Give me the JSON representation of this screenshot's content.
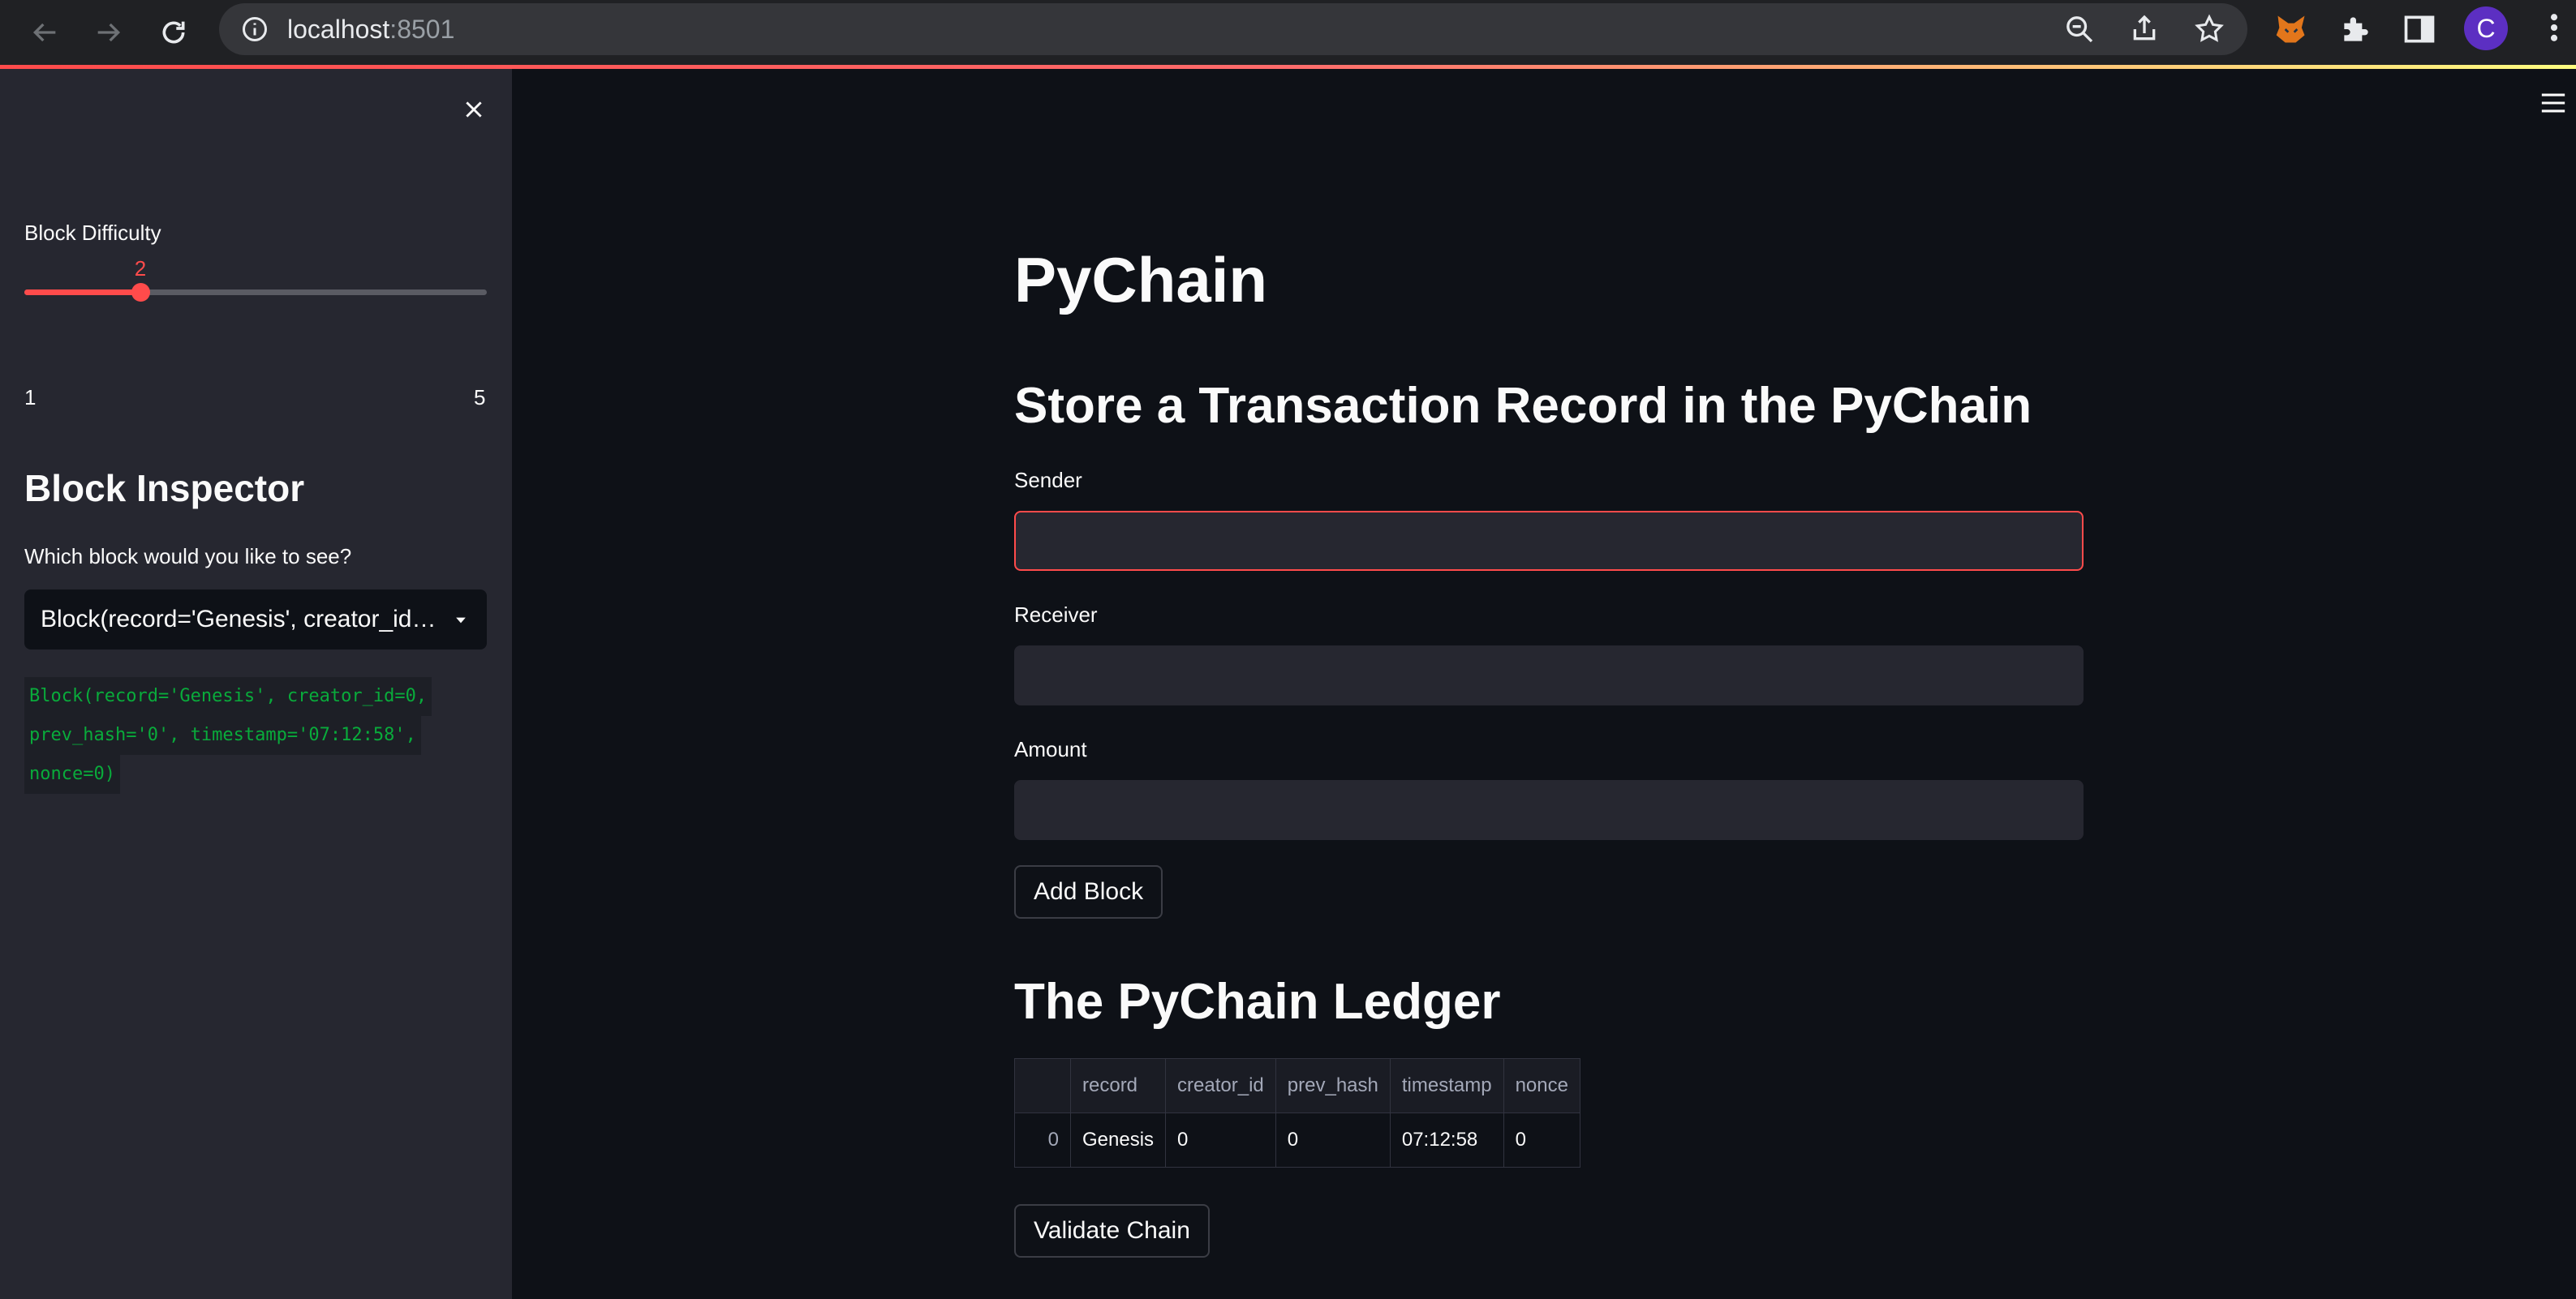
{
  "browser": {
    "url_host": "localhost",
    "url_port": ":8501",
    "profile_initial": "C"
  },
  "colors": {
    "accent": "#ff4b4b",
    "background": "#0e1117",
    "sidebar": "#262730",
    "code_text": "#09ab3b"
  },
  "sidebar": {
    "difficulty_label": "Block Difficulty",
    "slider": {
      "min": 1,
      "max": 5,
      "value": 2,
      "min_label": "1",
      "max_label": "5",
      "value_label": "2"
    },
    "inspector_title": "Block Inspector",
    "inspector_question": "Which block would you like to see?",
    "selected_block": "Block(record='Genesis', creator_id=0, prev_hash='0', timestamp='07:12:58', nonce=0)",
    "code_lines": [
      "Block(record='Genesis', creator_id=0,",
      "prev_hash='0', timestamp='07:12:58',",
      "nonce=0)"
    ]
  },
  "main": {
    "title": "PyChain",
    "form_title": "Store a Transaction Record in the PyChain",
    "sender_label": "Sender",
    "sender_value": "",
    "receiver_label": "Receiver",
    "receiver_value": "",
    "amount_label": "Amount",
    "amount_value": "",
    "add_block_label": "Add Block",
    "ledger_title": "The PyChain Ledger",
    "ledger": {
      "columns": [
        "record",
        "creator_id",
        "prev_hash",
        "timestamp",
        "nonce"
      ],
      "rows": [
        {
          "index": "0",
          "cells": [
            "Genesis",
            "0",
            "0",
            "07:12:58",
            "0"
          ]
        }
      ]
    },
    "validate_label": "Validate Chain"
  },
  "icons": {
    "back": "arrow-left-icon",
    "forward": "arrow-right-icon",
    "reload": "reload-icon",
    "info": "info-icon",
    "zoom": "zoom-out-icon",
    "share": "share-icon",
    "bookmark": "star-icon",
    "metamask": "fox-icon",
    "extensions": "puzzle-icon",
    "side_panel": "side-panel-icon",
    "menu": "kebab-menu-icon",
    "close": "close-icon",
    "hamburger": "hamburger-menu-icon",
    "dropdown": "chevron-down-icon"
  }
}
